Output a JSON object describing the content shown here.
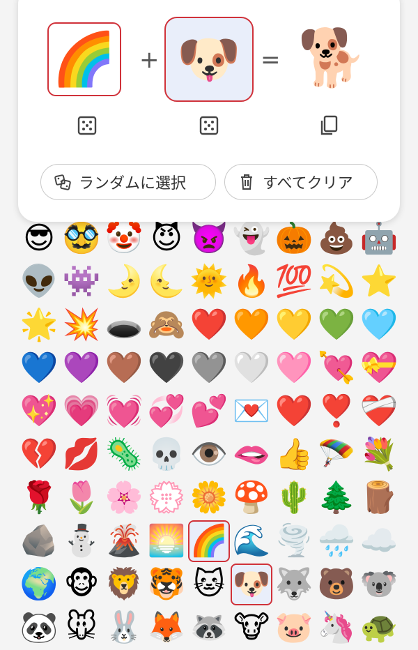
{
  "mixer": {
    "left_emoji": "🌈",
    "right_emoji": "🐶",
    "result_emoji": "🐕",
    "plus": "+",
    "equals": "="
  },
  "actions": {
    "random_label": "ランダムに選択",
    "clear_label": "すべてクリア"
  },
  "icons": {
    "dice": "dice-icon",
    "copy": "copy-icon",
    "random": "shuffle-dice-icon",
    "trash": "trash-icon"
  },
  "colors": {
    "selection_border": "#d0323a",
    "selection_fill": "#e9eefa"
  },
  "grid": {
    "selected": [
      "🌈",
      "🐶"
    ],
    "emojis": [
      "😎",
      "🥸",
      "🤡",
      "😈",
      "👿",
      "👻",
      "🎃",
      "💩",
      "🤖",
      "👽",
      "👾",
      "🌛",
      "🌜",
      "🌞",
      "🔥",
      "💯",
      "💫",
      "⭐",
      "🌟",
      "💥",
      "🕳️",
      "🙈",
      "❤️",
      "🧡",
      "💛",
      "💚",
      "🩵",
      "💙",
      "💜",
      "🤎",
      "🖤",
      "🩶",
      "🤍",
      "🩷",
      "💘",
      "💝",
      "💖",
      "💗",
      "💓",
      "💞",
      "💕",
      "💌",
      "❤️",
      "❣️",
      "❤️‍🩹",
      "💔",
      "💋",
      "🦠",
      "💀",
      "👁️",
      "🫦",
      "👍",
      "🪂",
      "💐",
      "🌹",
      "🌷",
      "🌸",
      "💮",
      "🌼",
      "🍄",
      "🌵",
      "🌲",
      "🪵",
      "🪨",
      "⛄",
      "🌋",
      "🌅",
      "🌈",
      "🌊",
      "🌪️",
      "🌧️",
      "☁️",
      "🌍",
      "🐵",
      "🦁",
      "🐯",
      "🐱",
      "🐶",
      "🐺",
      "🐻",
      "🐨",
      "🐼",
      "🐭",
      "🐰",
      "🦊",
      "🦝",
      "🐮",
      "🐷",
      "🦄",
      "🐢"
    ]
  }
}
